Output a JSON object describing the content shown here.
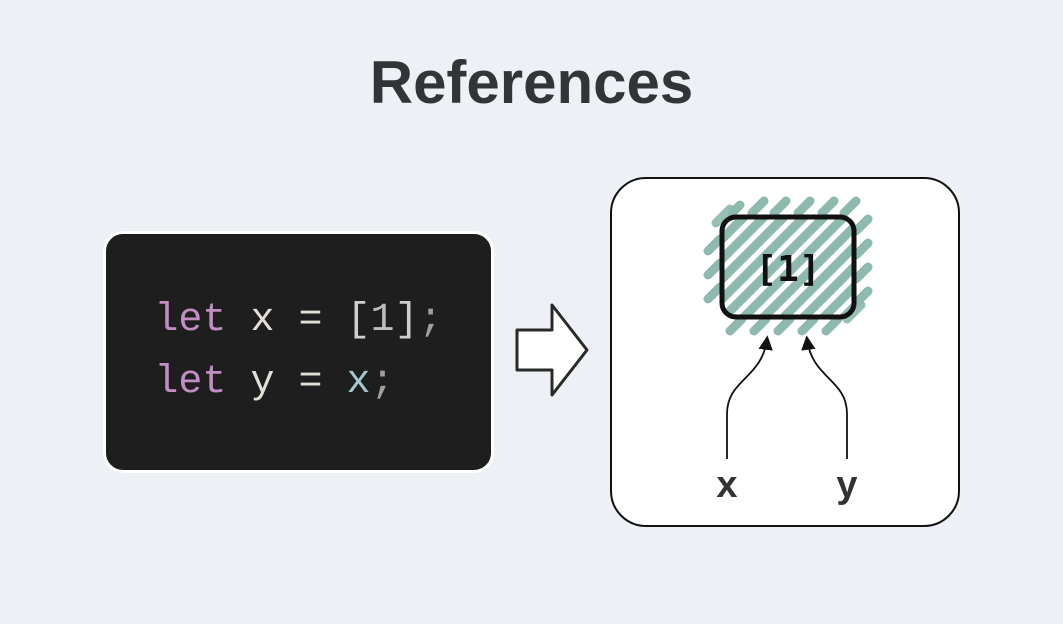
{
  "title": "References",
  "code": {
    "line1": {
      "kw": "let",
      "id": "x",
      "eq": "=",
      "open": "[",
      "num": "1",
      "close": "]",
      "semi": ";"
    },
    "line2": {
      "kw": "let",
      "id": "y",
      "eq": "=",
      "ref": "x",
      "semi": ";"
    }
  },
  "diagram": {
    "object_label": "[1]",
    "var_x": "x",
    "var_y": "y"
  }
}
